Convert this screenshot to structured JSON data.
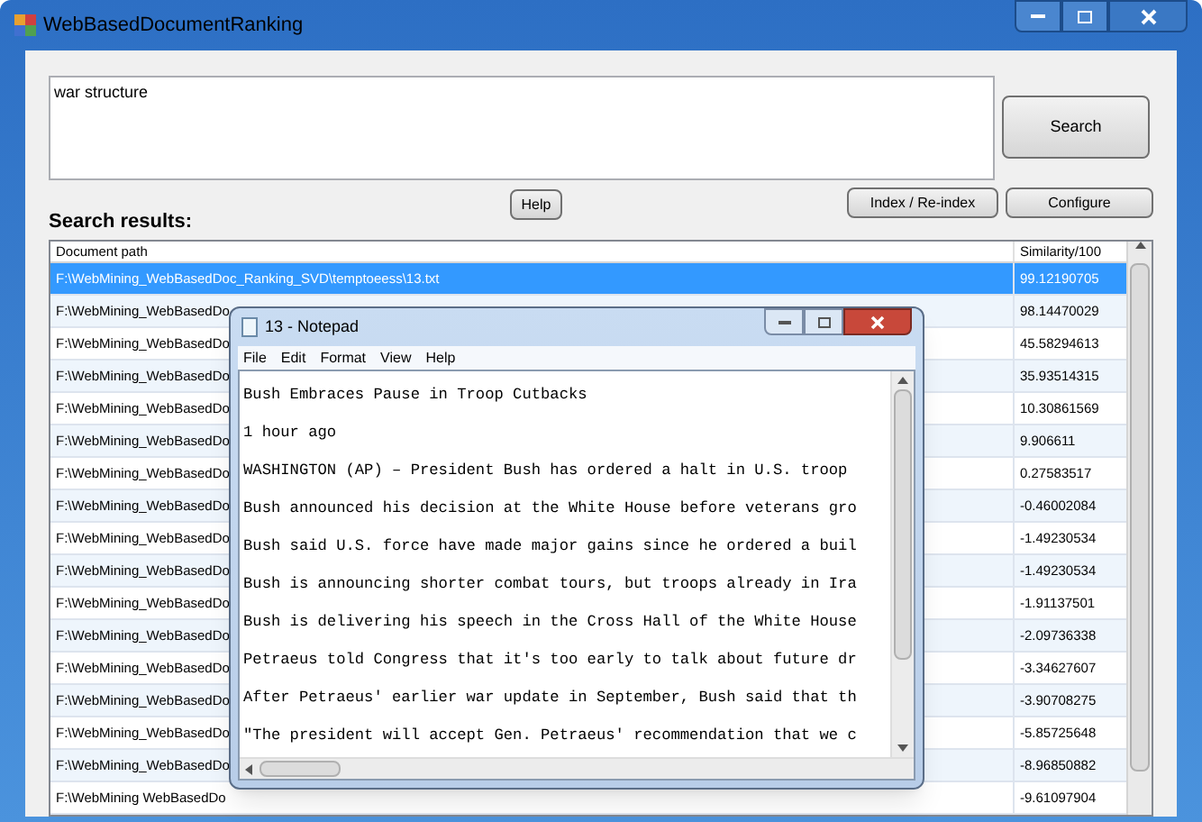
{
  "window": {
    "title": "WebBasedDocumentRanking"
  },
  "query": {
    "value": "war structure"
  },
  "buttons": {
    "search": "Search",
    "help": "Help",
    "index": "Index / Re-index",
    "configure": "Configure"
  },
  "results_label": "Search results:",
  "table": {
    "columns": [
      "Document path",
      "Similarity/100"
    ],
    "rows": [
      {
        "path": "F:\\WebMining_WebBasedDoc_Ranking_SVD\\temptoeess\\13.txt",
        "similarity": "99.12190705",
        "selected": true
      },
      {
        "path": "F:\\WebMining_WebBasedDo",
        "similarity": "98.14470029",
        "selected": false
      },
      {
        "path": "F:\\WebMining_WebBasedDo",
        "similarity": "45.58294613",
        "selected": false
      },
      {
        "path": "F:\\WebMining_WebBasedDo",
        "similarity": "35.93514315",
        "selected": false
      },
      {
        "path": "F:\\WebMining_WebBasedDo",
        "similarity": "10.30861569",
        "selected": false
      },
      {
        "path": "F:\\WebMining_WebBasedDo",
        "similarity": "9.906611",
        "selected": false
      },
      {
        "path": "F:\\WebMining_WebBasedDo",
        "similarity": "0.27583517",
        "selected": false
      },
      {
        "path": "F:\\WebMining_WebBasedDo",
        "similarity": "-0.46002084",
        "selected": false
      },
      {
        "path": "F:\\WebMining_WebBasedDo",
        "similarity": "-1.49230534",
        "selected": false
      },
      {
        "path": "F:\\WebMining_WebBasedDo",
        "similarity": "-1.49230534",
        "selected": false
      },
      {
        "path": "F:\\WebMining_WebBasedDo",
        "similarity": "-1.91137501",
        "selected": false
      },
      {
        "path": "F:\\WebMining_WebBasedDo",
        "similarity": "-2.09736338",
        "selected": false
      },
      {
        "path": "F:\\WebMining_WebBasedDo",
        "similarity": "-3.34627607",
        "selected": false
      },
      {
        "path": "F:\\WebMining_WebBasedDo",
        "similarity": "-3.90708275",
        "selected": false
      },
      {
        "path": "F:\\WebMining_WebBasedDo",
        "similarity": "-5.85725648",
        "selected": false
      },
      {
        "path": "F:\\WebMining_WebBasedDo",
        "similarity": "-8.96850882",
        "selected": false
      },
      {
        "path": "F:\\WebMining WebBasedDo",
        "similarity": "-9.61097904",
        "selected": false
      }
    ]
  },
  "notepad": {
    "title": "13 - Notepad",
    "menu": [
      "File",
      "Edit",
      "Format",
      "View",
      "Help"
    ],
    "lines": [
      "Bush Embraces Pause in Troop Cutbacks",
      "1 hour ago",
      "WASHINGTON (AP) – President Bush has ordered a halt in U.S. troop",
      "Bush announced his decision at the White House before veterans gro",
      "Bush said U.S. force have made major gains since he ordered a buil",
      "Bush is announcing shorter combat tours, but troops already in Ira",
      "Bush is delivering his speech in the Cross Hall of the White House",
      "Petraeus told Congress that it's too early to talk about future dr",
      "After Petraeus' earlier war update in September, Bush said that th",
      "\"The president will accept Gen. Petraeus' recommendation that we c"
    ]
  }
}
